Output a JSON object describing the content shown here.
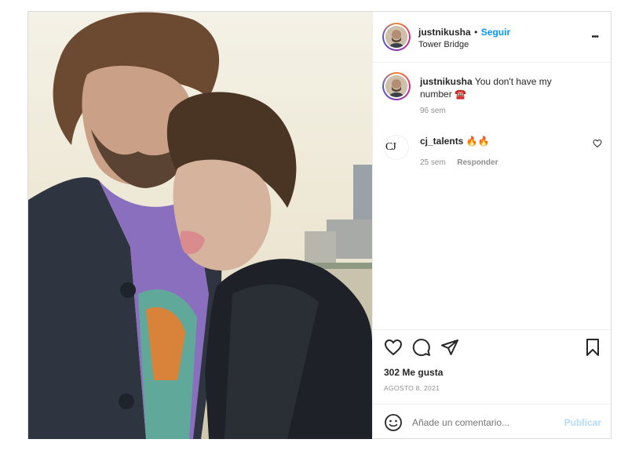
{
  "post": {
    "username": "justnikusha",
    "separator": "•",
    "follow_label": "Seguir",
    "location": "Tower Bridge",
    "more_label": "•••"
  },
  "caption": {
    "username": "justnikusha",
    "text": "You don't have my number ☎️",
    "age": "96 sem"
  },
  "comments": [
    {
      "username": "cj_talents",
      "text": "🔥🔥",
      "age": "25 sem",
      "reply_label": "Responder",
      "avatar_text": "CJ"
    }
  ],
  "stats": {
    "likes": "302 Me gusta",
    "date": "AGOSTO 8, 2021"
  },
  "composer": {
    "placeholder": "Añade un comentario...",
    "publish_label": "Publicar"
  },
  "icons": {
    "like": "heart-icon",
    "comment": "comment-icon",
    "share": "paper-plane-icon",
    "save": "bookmark-icon",
    "emoji": "smiley-icon",
    "comment_like": "small-heart-icon"
  },
  "colors": {
    "link": "#0095f6",
    "text": "#262626",
    "muted": "#8e8e8e",
    "border": "#dbdbdb",
    "publish_disabled": "#b3dbff"
  }
}
